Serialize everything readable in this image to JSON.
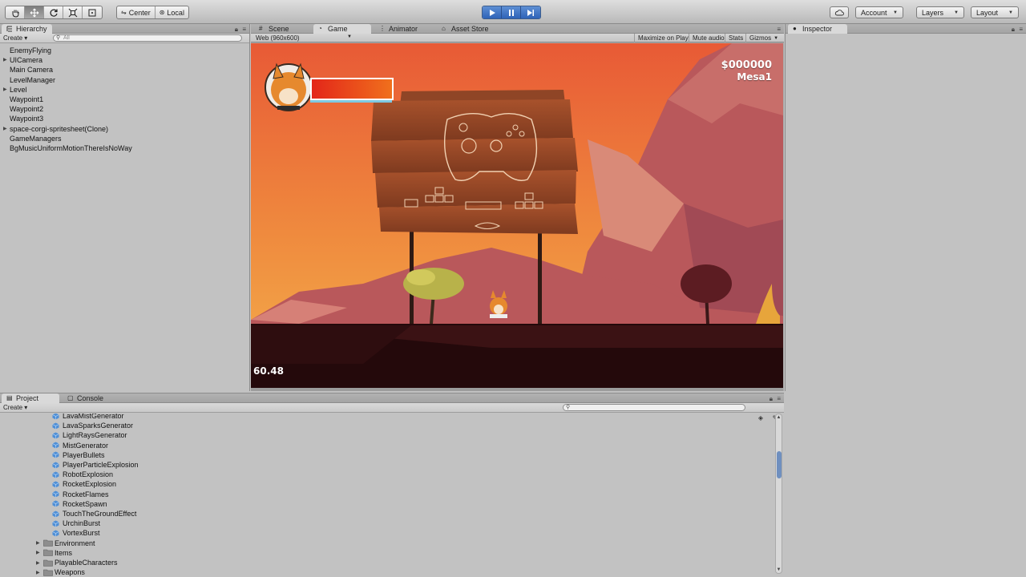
{
  "toolbar": {
    "transform_tools": [
      "hand-tool",
      "move-tool",
      "rotate-tool",
      "scale-tool",
      "rect-tool"
    ],
    "pivot_label": "Center",
    "space_label": "Local",
    "account_label": "Account",
    "layers_label": "Layers",
    "layout_label": "Layout"
  },
  "hierarchy": {
    "tab_label": "Hierarchy",
    "create_label": "Create",
    "search_placeholder": "All",
    "items": [
      {
        "label": "EnemyFlying",
        "expandable": false
      },
      {
        "label": "UICamera",
        "expandable": true
      },
      {
        "label": "Main Camera",
        "expandable": false
      },
      {
        "label": "LevelManager",
        "expandable": false
      },
      {
        "label": "Level",
        "expandable": true
      },
      {
        "label": "Waypoint1",
        "expandable": false
      },
      {
        "label": "Waypoint2",
        "expandable": false
      },
      {
        "label": "Waypoint3",
        "expandable": false
      },
      {
        "label": "space-corgi-spritesheet(Clone)",
        "expandable": true
      },
      {
        "label": "GameManagers",
        "expandable": false
      },
      {
        "label": "BgMusicUniformMotionThereIsNoWay",
        "expandable": false
      }
    ]
  },
  "center_tabs": {
    "scene_label": "Scene",
    "game_label": "Game",
    "animator_label": "Animator",
    "asset_store_label": "Asset Store"
  },
  "game_view": {
    "resolution": "Web (960x600)",
    "maximize_label": "Maximize on Play",
    "mute_label": "Mute audio",
    "stats_label": "Stats",
    "gizmos_label": "Gizmos",
    "money": "$000000",
    "level_name": "Mesa1",
    "fps": "60.48",
    "health_fraction": 1.0
  },
  "inspector": {
    "tab_label": "Inspector"
  },
  "project": {
    "tab_label": "Project",
    "console_label": "Console",
    "create_label": "Create",
    "items": [
      {
        "label": "LavaMistGenerator",
        "kind": "prefab"
      },
      {
        "label": "LavaSparksGenerator",
        "kind": "prefab"
      },
      {
        "label": "LightRaysGenerator",
        "kind": "prefab"
      },
      {
        "label": "MistGenerator",
        "kind": "prefab"
      },
      {
        "label": "PlayerBullets",
        "kind": "prefab"
      },
      {
        "label": "PlayerParticleExplosion",
        "kind": "prefab"
      },
      {
        "label": "RobotExplosion",
        "kind": "prefab"
      },
      {
        "label": "RocketExplosion",
        "kind": "prefab"
      },
      {
        "label": "RocketFlames",
        "kind": "prefab"
      },
      {
        "label": "RocketSpawn",
        "kind": "prefab"
      },
      {
        "label": "TouchTheGroundEffect",
        "kind": "prefab"
      },
      {
        "label": "UrchinBurst",
        "kind": "prefab"
      },
      {
        "label": "VortexBurst",
        "kind": "prefab"
      },
      {
        "label": "Environment",
        "kind": "folder"
      },
      {
        "label": "Items",
        "kind": "folder"
      },
      {
        "label": "PlayableCharacters",
        "kind": "folder"
      },
      {
        "label": "Weapons",
        "kind": "folder"
      }
    ]
  },
  "colors": {
    "play_blue": "#3a73c9",
    "panel_gray": "#c2c2c2",
    "prefab_blue": "#4f8fd6",
    "sky_top": "#e8603a",
    "sky_bottom": "#f2a24a",
    "health_red": "#e7321f"
  }
}
